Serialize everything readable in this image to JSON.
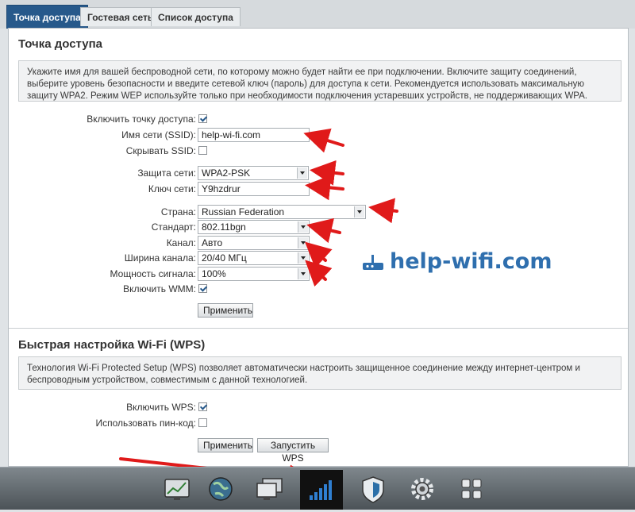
{
  "tabs": [
    {
      "label": "Точка доступа",
      "active": true
    },
    {
      "label": "Гостевая сеть",
      "active": false
    },
    {
      "label": "Список доступа",
      "active": false
    }
  ],
  "ap_section": {
    "title": "Точка доступа",
    "info": "Укажите имя для вашей беспроводной сети, по которому можно будет найти ее при подключении. Включите защиту соединений, выберите уровень безопасности и введите сетевой ключ (пароль) для доступа к сети. Рекомендуется использовать максимальную защиту WPA2. Режим WEP используйте только при необходимости подключения устаревших устройств, не поддерживающих WPA.",
    "enable_ap": {
      "label": "Включить точку доступа:",
      "checked": true
    },
    "ssid": {
      "label": "Имя сети (SSID):",
      "value": "help-wi-fi.com"
    },
    "hide_ssid": {
      "label": "Скрывать SSID:",
      "checked": false
    },
    "security": {
      "label": "Защита сети:",
      "value": "WPA2-PSK"
    },
    "key": {
      "label": "Ключ сети:",
      "value": "Y9hzdrur"
    },
    "country": {
      "label": "Страна:",
      "value": "Russian Federation"
    },
    "standard": {
      "label": "Стандарт:",
      "value": "802.11bgn"
    },
    "channel": {
      "label": "Канал:",
      "value": "Авто"
    },
    "width": {
      "label": "Ширина канала:",
      "value": "20/40 МГц"
    },
    "power": {
      "label": "Мощность сигнала:",
      "value": "100%"
    },
    "wmm": {
      "label": "Включить WMM:",
      "checked": true
    },
    "apply_label": "Применить"
  },
  "wps_section": {
    "title": "Быстрая настройка Wi-Fi (WPS)",
    "info": "Технология Wi-Fi Protected Setup (WPS) позволяет автоматически настроить защищенное соединение между интернет-центром и беспроводным устройством, совместимым с данной технологией.",
    "enable_wps": {
      "label": "Включить WPS:",
      "checked": true
    },
    "use_pin": {
      "label": "Использовать пин-код:",
      "checked": false
    },
    "apply_label": "Применить",
    "start_label": "Запустить WPS"
  },
  "watermark": "help-wifi.com",
  "dock": [
    {
      "icon": "monitor-chart-icon",
      "active": false
    },
    {
      "icon": "globe-icon",
      "active": false
    },
    {
      "icon": "network-computers-icon",
      "active": false
    },
    {
      "icon": "wifi-signal-icon",
      "active": true
    },
    {
      "icon": "shield-icon",
      "active": false
    },
    {
      "icon": "gear-icon",
      "active": false
    },
    {
      "icon": "apps-grid-icon",
      "active": false
    }
  ],
  "colors": {
    "accent": "#27598b",
    "arrow": "#e01a1a",
    "watermark": "#2f6fae"
  }
}
